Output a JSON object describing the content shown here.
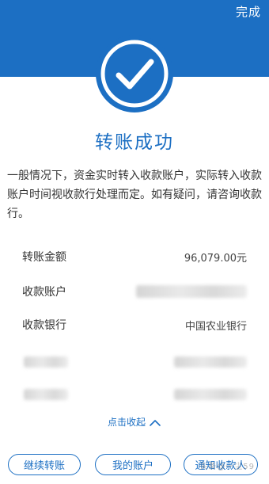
{
  "header": {
    "done_label": "完成",
    "accent_color": "#1c6fc3"
  },
  "result": {
    "icon": "check-circle-icon",
    "title": "转账成功",
    "description": "一般情况下，资金实时转入收款账户，实际转入收款账户时间视收款行处理而定。如有疑问，请咨询收款行。"
  },
  "details": [
    {
      "label": "转账金额",
      "value": "96,079.00元"
    },
    {
      "label": "收款账户",
      "value": ""
    },
    {
      "label": "收款银行",
      "value": "中国农业银行"
    }
  ],
  "collapse": {
    "label": "点击收起",
    "icon": "chevron-up-icon"
  },
  "actions": {
    "continue_label": "继续转账",
    "my_account_label": "我的账户",
    "notify_label": "通知收款人"
  },
  "watermark": "头条@一尘59"
}
